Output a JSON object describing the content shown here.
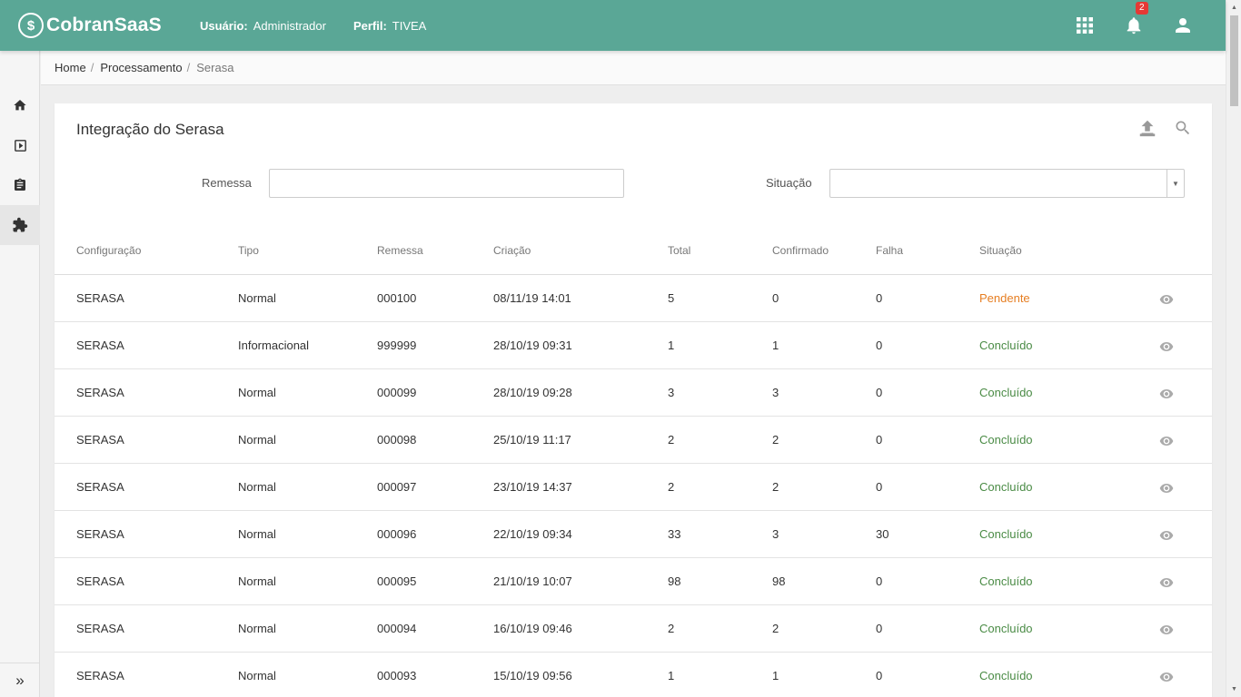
{
  "app": {
    "logo_mark": "$",
    "name": "CobranSaaS"
  },
  "user": {
    "user_label": "Usuário:",
    "user_value": "Administrador",
    "profile_label": "Perfil:",
    "profile_value": "TIVEA"
  },
  "topbar": {
    "icons": [
      "apps-grid-icon",
      "bell-icon",
      "account-icon"
    ],
    "notification_count": "2"
  },
  "sidebar": {
    "items": [
      "home-icon",
      "play-box-icon",
      "clipboard-icon",
      "puzzle-icon"
    ],
    "active_index": 3,
    "expand_label": "»"
  },
  "breadcrumb": {
    "home": "Home",
    "processing": "Processamento",
    "current": "Serasa"
  },
  "page": {
    "title": "Integração do Serasa",
    "actions": [
      "upload-icon",
      "search-icon"
    ]
  },
  "filters": {
    "remessa_label": "Remessa",
    "remessa_value": "",
    "situacao_label": "Situação",
    "situacao_value": ""
  },
  "table": {
    "headers": [
      "Configuração",
      "Tipo",
      "Remessa",
      "Criação",
      "Total",
      "Confirmado",
      "Falha",
      "Situação"
    ],
    "rows": [
      [
        "SERASA",
        "Normal",
        "000100",
        "08/11/19 14:01",
        "5",
        "0",
        "0",
        "Pendente"
      ],
      [
        "SERASA",
        "Informacional",
        "999999",
        "28/10/19 09:31",
        "1",
        "1",
        "0",
        "Concluído"
      ],
      [
        "SERASA",
        "Normal",
        "000099",
        "28/10/19 09:28",
        "3",
        "3",
        "0",
        "Concluído"
      ],
      [
        "SERASA",
        "Normal",
        "000098",
        "25/10/19 11:17",
        "2",
        "2",
        "0",
        "Concluído"
      ],
      [
        "SERASA",
        "Normal",
        "000097",
        "23/10/19 14:37",
        "2",
        "2",
        "0",
        "Concluído"
      ],
      [
        "SERASA",
        "Normal",
        "000096",
        "22/10/19 09:34",
        "33",
        "3",
        "30",
        "Concluído"
      ],
      [
        "SERASA",
        "Normal",
        "000095",
        "21/10/19 10:07",
        "98",
        "98",
        "0",
        "Concluído"
      ],
      [
        "SERASA",
        "Normal",
        "000094",
        "16/10/19 09:46",
        "2",
        "2",
        "0",
        "Concluído"
      ],
      [
        "SERASA",
        "Normal",
        "000093",
        "15/10/19 09:56",
        "1",
        "1",
        "0",
        "Concluído"
      ]
    ]
  },
  "colors": {
    "header_bg": "#5aa796",
    "pending": "#e67e22",
    "done": "#4a8b45",
    "badge": "#e53935"
  }
}
